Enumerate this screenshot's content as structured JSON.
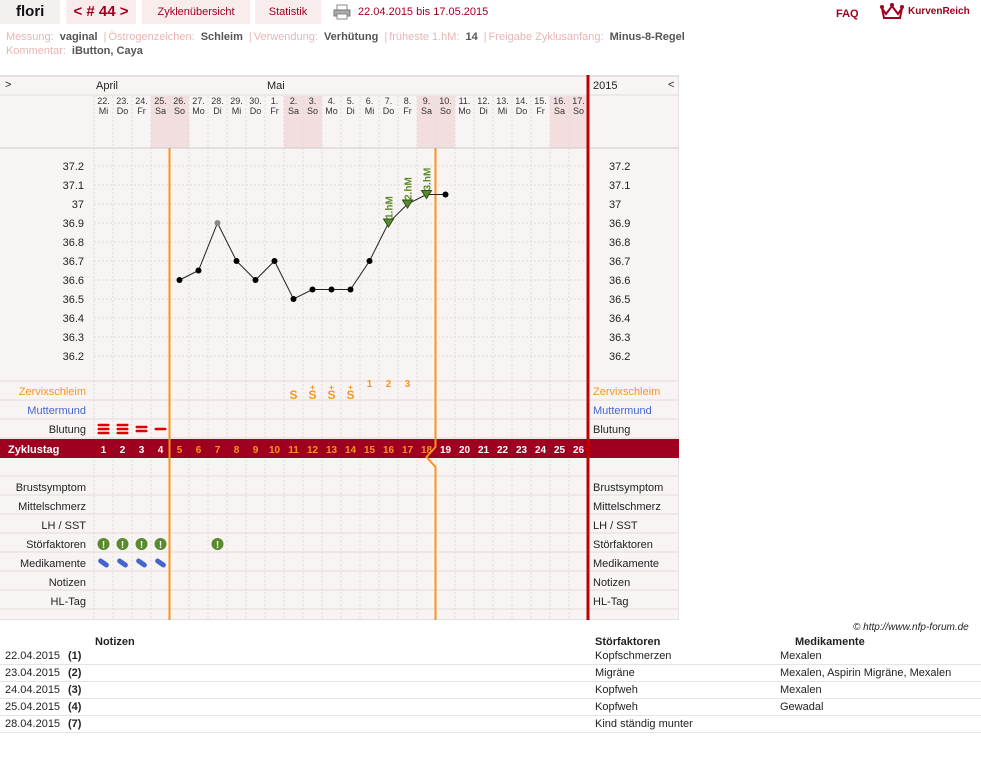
{
  "header": {
    "user": "flori",
    "cycle_prev": "<",
    "cycle_label": "# 44",
    "cycle_next": ">",
    "tab_overview": "Zyklenübersicht",
    "tab_stats": "Statistik",
    "date_range": "22.04.2015 bis 17.05.2015",
    "faq": "FAQ",
    "brand": "KurvenReich"
  },
  "info": {
    "line1": [
      {
        "label": "Messung:",
        "value": "vaginal"
      },
      {
        "label": "Östrogenzeichen:",
        "value": "Schleim"
      },
      {
        "label": "Verwendung:",
        "value": "Verhütung"
      },
      {
        "label": "früheste 1.hM:",
        "value": "14"
      },
      {
        "label": "Freigabe Zyklusanfang:",
        "value": "Minus-8-Regel"
      }
    ],
    "line2": [
      {
        "label": "Kommentar:",
        "value": "iButton, Caya"
      }
    ]
  },
  "chart": {
    "nav_left": ">",
    "nav_right": "<",
    "year": "2015",
    "months": [
      {
        "label": "April",
        "day_index": 0
      },
      {
        "label": "Mai",
        "day_index": 9
      }
    ],
    "days": [
      {
        "num": "22.",
        "dow": "Mi"
      },
      {
        "num": "23.",
        "dow": "Do"
      },
      {
        "num": "24.",
        "dow": "Fr"
      },
      {
        "num": "25.",
        "dow": "Sa",
        "weekend": true
      },
      {
        "num": "26.",
        "dow": "So",
        "weekend": true
      },
      {
        "num": "27.",
        "dow": "Mo"
      },
      {
        "num": "28.",
        "dow": "Di"
      },
      {
        "num": "29.",
        "dow": "Mi"
      },
      {
        "num": "30.",
        "dow": "Do"
      },
      {
        "num": "1.",
        "dow": "Fr"
      },
      {
        "num": "2.",
        "dow": "Sa",
        "weekend": true
      },
      {
        "num": "3.",
        "dow": "So",
        "weekend": true
      },
      {
        "num": "4.",
        "dow": "Mo"
      },
      {
        "num": "5.",
        "dow": "Di"
      },
      {
        "num": "6.",
        "dow": "Mi"
      },
      {
        "num": "7.",
        "dow": "Do"
      },
      {
        "num": "8.",
        "dow": "Fr"
      },
      {
        "num": "9.",
        "dow": "Sa",
        "weekend": true
      },
      {
        "num": "10.",
        "dow": "So",
        "weekend": true
      },
      {
        "num": "11.",
        "dow": "Mo"
      },
      {
        "num": "12.",
        "dow": "Di"
      },
      {
        "num": "13.",
        "dow": "Mi"
      },
      {
        "num": "14.",
        "dow": "Do"
      },
      {
        "num": "15.",
        "dow": "Fr"
      },
      {
        "num": "16.",
        "dow": "Sa",
        "weekend": true
      },
      {
        "num": "17.",
        "dow": "So",
        "weekend": true
      }
    ],
    "temp_ticks": [
      "37.2",
      "37.1",
      "37",
      "36.9",
      "36.8",
      "36.7",
      "36.6",
      "36.5",
      "36.4",
      "36.3",
      "36.2"
    ],
    "temperatures": [
      null,
      null,
      null,
      null,
      36.6,
      36.65,
      36.9,
      36.7,
      36.6,
      36.7,
      36.5,
      36.55,
      36.55,
      36.55,
      36.7,
      36.9,
      37.0,
      37.05,
      37.05,
      null,
      null,
      null,
      null,
      null,
      null,
      null
    ],
    "excluded_days": [
      6
    ],
    "high_measurements": [
      {
        "day_index": 15,
        "label": "1.hM"
      },
      {
        "day_index": 16,
        "label": "2.hM"
      },
      {
        "day_index": 17,
        "label": "3.hM"
      }
    ],
    "count_labels": [
      {
        "day_index": 14,
        "label": "1"
      },
      {
        "day_index": 15,
        "label": "2"
      },
      {
        "day_index": 16,
        "label": "3"
      }
    ],
    "mucus": [
      {
        "day_index": 10,
        "label": "S"
      },
      {
        "day_index": 11,
        "label": "S+"
      },
      {
        "day_index": 12,
        "label": "S+"
      },
      {
        "day_index": 13,
        "label": "S+"
      }
    ],
    "bleeding": [
      3,
      3,
      2,
      1
    ],
    "cycle_days": [
      "1",
      "2",
      "3",
      "4",
      "5",
      "6",
      "7",
      "8",
      "9",
      "10",
      "11",
      "12",
      "13",
      "14",
      "15",
      "16",
      "17",
      "18",
      "19",
      "20",
      "21",
      "22",
      "23",
      "24",
      "25",
      "26"
    ],
    "highlight_day_start": 4,
    "highlight_day_end": 17,
    "bottom_labels": {
      "zervix": "Zervixschleim",
      "muttermund": "Muttermund",
      "blutung": "Blutung",
      "zyklustag": "Zyklustag",
      "brust": "Brustsymptom",
      "mittel": "Mittelschmerz",
      "lh": "LH / SST",
      "stoer": "Störfaktoren",
      "medi": "Medikamente",
      "notizen": "Notizen",
      "hltag": "HL-Tag"
    },
    "disturbance_days": [
      0,
      1,
      2,
      3,
      6
    ],
    "medication_days": [
      0,
      1,
      2,
      3
    ],
    "colors": {
      "orange": "#f7941d",
      "red": "#c00000",
      "cycle_bar": "#a00020",
      "mucus": "#f7941d",
      "muttermund": "#4466cc",
      "green": "#5a8a2e",
      "pill": "#4466cc"
    }
  },
  "copyright": "© http://www.nfp-forum.de",
  "notes": {
    "headers": {
      "notizen": "Notizen",
      "stoer": "Störfaktoren",
      "medi": "Medikamente"
    },
    "rows": [
      {
        "date": "22.04.2015",
        "num": "(1)",
        "stoer": "Kopfschmerzen",
        "medi": "Mexalen"
      },
      {
        "date": "23.04.2015",
        "num": "(2)",
        "stoer": "Migräne",
        "medi": "Mexalen, Aspirin Migräne, Mexalen"
      },
      {
        "date": "24.04.2015",
        "num": "(3)",
        "stoer": "Kopfweh",
        "medi": "Mexalen"
      },
      {
        "date": "25.04.2015",
        "num": "(4)",
        "stoer": "Kopfweh",
        "medi": "Gewadal"
      },
      {
        "date": "28.04.2015",
        "num": "(7)",
        "stoer": "Kind ständig munter",
        "medi": ""
      }
    ]
  }
}
